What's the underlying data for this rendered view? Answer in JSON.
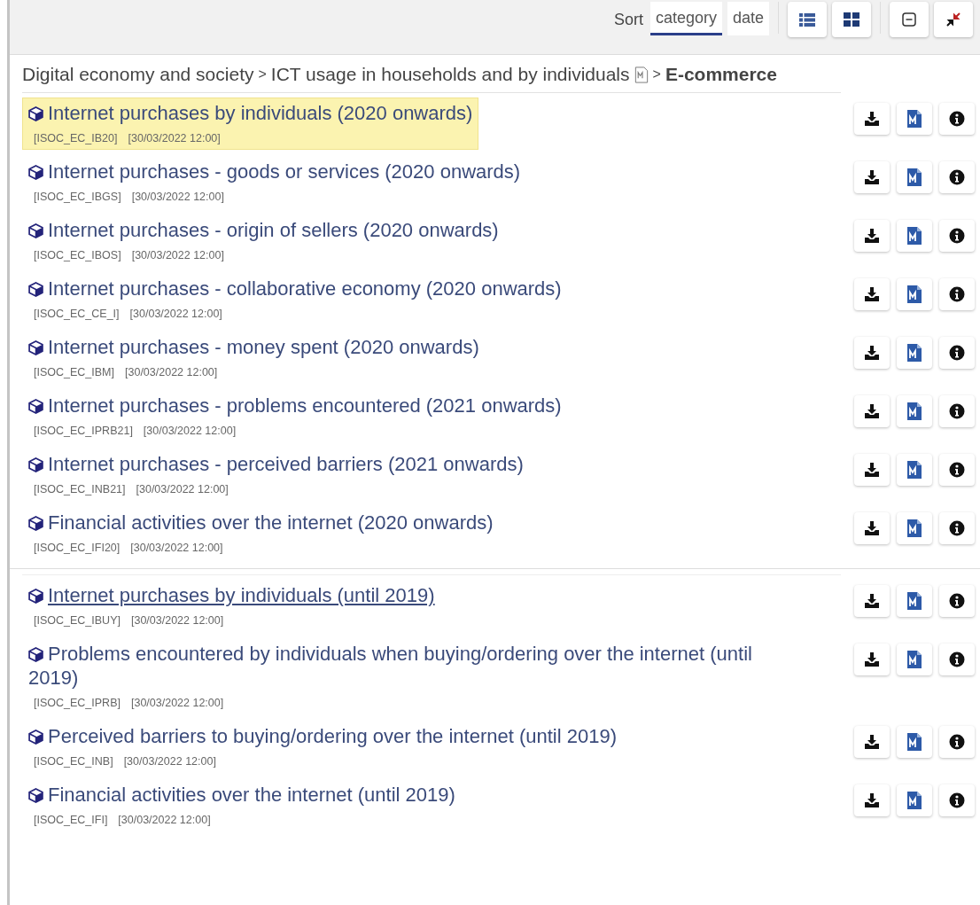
{
  "toolbar": {
    "sort_label": "Sort",
    "sort_options": [
      {
        "label": "category",
        "selected": true
      },
      {
        "label": "date",
        "selected": false
      }
    ]
  },
  "breadcrumb": {
    "separator": ">",
    "items": [
      {
        "label": "Digital economy and society",
        "metadata_link": false,
        "current": false
      },
      {
        "label": "ICT usage in households and by individuals",
        "metadata_link": true,
        "current": false
      },
      {
        "label": "E-commerce",
        "metadata_link": false,
        "current": true
      }
    ]
  },
  "groups": [
    {
      "datasets": [
        {
          "title": "Internet purchases by individuals (2020 onwards)",
          "code": "[ISOC_EC_IB20]",
          "updated": "[30/03/2022 12:00]",
          "highlighted": true,
          "hovered": false
        },
        {
          "title": "Internet purchases - goods or services (2020 onwards)",
          "code": "[ISOC_EC_IBGS]",
          "updated": "[30/03/2022 12:00]",
          "highlighted": false,
          "hovered": false
        },
        {
          "title": "Internet purchases - origin of sellers (2020 onwards)",
          "code": "[ISOC_EC_IBOS]",
          "updated": "[30/03/2022 12:00]",
          "highlighted": false,
          "hovered": false
        },
        {
          "title": "Internet purchases - collaborative economy (2020 onwards)",
          "code": "[ISOC_EC_CE_I]",
          "updated": "[30/03/2022 12:00]",
          "highlighted": false,
          "hovered": false
        },
        {
          "title": "Internet purchases - money spent (2020 onwards)",
          "code": "[ISOC_EC_IBM]",
          "updated": "[30/03/2022 12:00]",
          "highlighted": false,
          "hovered": false
        },
        {
          "title": "Internet purchases - problems encountered (2021 onwards)",
          "code": "[ISOC_EC_IPRB21]",
          "updated": "[30/03/2022 12:00]",
          "highlighted": false,
          "hovered": false
        },
        {
          "title": "Internet purchases - perceived barriers (2021 onwards)",
          "code": "[ISOC_EC_INB21]",
          "updated": "[30/03/2022 12:00]",
          "highlighted": false,
          "hovered": false
        },
        {
          "title": "Financial activities over the internet (2020 onwards)",
          "code": "[ISOC_EC_IFI20]",
          "updated": "[30/03/2022 12:00]",
          "highlighted": false,
          "hovered": false
        }
      ]
    },
    {
      "datasets": [
        {
          "title": "Internet purchases by individuals (until 2019)",
          "code": "[ISOC_EC_IBUY]",
          "updated": "[30/03/2022 12:00]",
          "highlighted": false,
          "hovered": true
        },
        {
          "title": "Problems encountered by individuals when buying/ordering over the internet (until 2019)",
          "code": "[ISOC_EC_IPRB]",
          "updated": "[30/03/2022 12:00]",
          "highlighted": false,
          "hovered": false
        },
        {
          "title": "Perceived barriers to buying/ordering over the internet (until 2019)",
          "code": "[ISOC_EC_INB]",
          "updated": "[30/03/2022 12:00]",
          "highlighted": false,
          "hovered": false
        },
        {
          "title": "Financial activities over the internet (until 2019)",
          "code": "[ISOC_EC_IFI]",
          "updated": "[30/03/2022 12:00]",
          "highlighted": false,
          "hovered": false
        }
      ]
    }
  ]
}
